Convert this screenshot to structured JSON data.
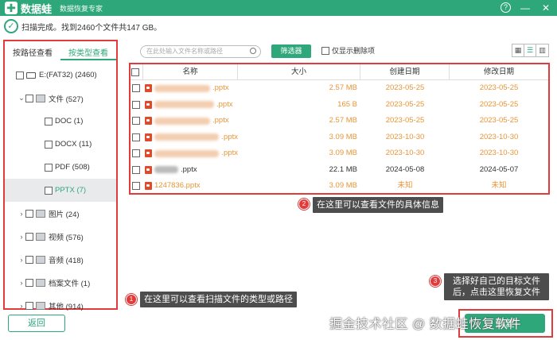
{
  "app": {
    "name": "数据蛙",
    "subtitle": "数据恢复专家",
    "logo_glyph": "✚",
    "accent": "#2ea77b",
    "window_controls": [
      "?",
      "—",
      "✕"
    ]
  },
  "status": {
    "text": "扫描完成。找到2460个文件共147 GB。"
  },
  "left_panel": {
    "tabs": [
      "按路径查看",
      "按类型查看"
    ],
    "active_tab": 1,
    "tree": [
      {
        "label": "E:(FAT32) (2460)",
        "indent": 0,
        "chevron": "",
        "icon": "drive-icon",
        "selected": false
      },
      {
        "label": "文件 (527)",
        "indent": 1,
        "chevron": "⌄",
        "icon": "document-folder-icon",
        "selected": false
      },
      {
        "label": "DOC (1)",
        "indent": 2,
        "chevron": "",
        "icon": "",
        "selected": false
      },
      {
        "label": "DOCX (11)",
        "indent": 2,
        "chevron": "",
        "icon": "",
        "selected": false
      },
      {
        "label": "PDF (508)",
        "indent": 2,
        "chevron": "",
        "icon": "",
        "selected": false
      },
      {
        "label": "PPTX (7)",
        "indent": 2,
        "chevron": "",
        "icon": "",
        "selected": true
      },
      {
        "label": "图片 (24)",
        "indent": 1,
        "chevron": "›",
        "icon": "image-icon",
        "selected": false
      },
      {
        "label": "视频 (576)",
        "indent": 1,
        "chevron": "›",
        "icon": "video-icon",
        "selected": false
      },
      {
        "label": "音频 (418)",
        "indent": 1,
        "chevron": "›",
        "icon": "audio-icon",
        "selected": false
      },
      {
        "label": "档案文件 (1)",
        "indent": 1,
        "chevron": "›",
        "icon": "archive-icon",
        "selected": false
      },
      {
        "label": "其他 (914)",
        "indent": 1,
        "chevron": "›",
        "icon": "folder-icon",
        "selected": false
      }
    ],
    "back_label": "返回"
  },
  "toolbar": {
    "search_placeholder": "在此处输入文件名称或路径",
    "filter_label": "筛选器",
    "deleted_only_label": "仅显示删除项",
    "view_modes": [
      "grid-view-icon",
      "list-view-icon",
      "detail-view-icon"
    ]
  },
  "table": {
    "columns": [
      "名称",
      "大小",
      "创建日期",
      "修改日期"
    ],
    "rows": [
      {
        "name": ".pptx",
        "size": "2.57 MB",
        "created": "2023-05-25",
        "modified": "2023-05-25",
        "color": "orange",
        "blur_width": 70
      },
      {
        "name": ".pptx",
        "size": "165 B",
        "created": "2023-05-25",
        "modified": "2023-05-25",
        "color": "orange",
        "blur_width": 75
      },
      {
        "name": ".pptx",
        "size": "2.57 MB",
        "created": "2023-05-25",
        "modified": "2023-05-25",
        "color": "orange",
        "blur_width": 70
      },
      {
        "name": ".pptx",
        "size": "3.09 MB",
        "created": "2023-10-30",
        "modified": "2023-10-30",
        "color": "orange",
        "blur_width": 82
      },
      {
        "name": ".pptx",
        "size": "3.09 MB",
        "created": "2023-10-30",
        "modified": "2023-10-30",
        "color": "orange",
        "blur_width": 82
      },
      {
        "name": ".pptx",
        "size": "22.1 MB",
        "created": "2024-05-08",
        "modified": "2024-05-07",
        "color": "dark",
        "blur_width": 30
      },
      {
        "name": "1247836.pptx",
        "size": "3.09 MB",
        "created": "未知",
        "modified": "未知",
        "color": "orange",
        "blur_width": 0
      }
    ]
  },
  "annotations": [
    {
      "num": "1",
      "text": "在这里可以查看扫描文件的类型或路径"
    },
    {
      "num": "2",
      "text": "在这里可以查看文件的具体信息"
    },
    {
      "num": "3",
      "text": "选择好自己的目标文件后，点击这里恢复文件"
    }
  ],
  "watermark": "掘金技术社区 @ 数据蛙恢复软件",
  "recover_label": "恢复"
}
